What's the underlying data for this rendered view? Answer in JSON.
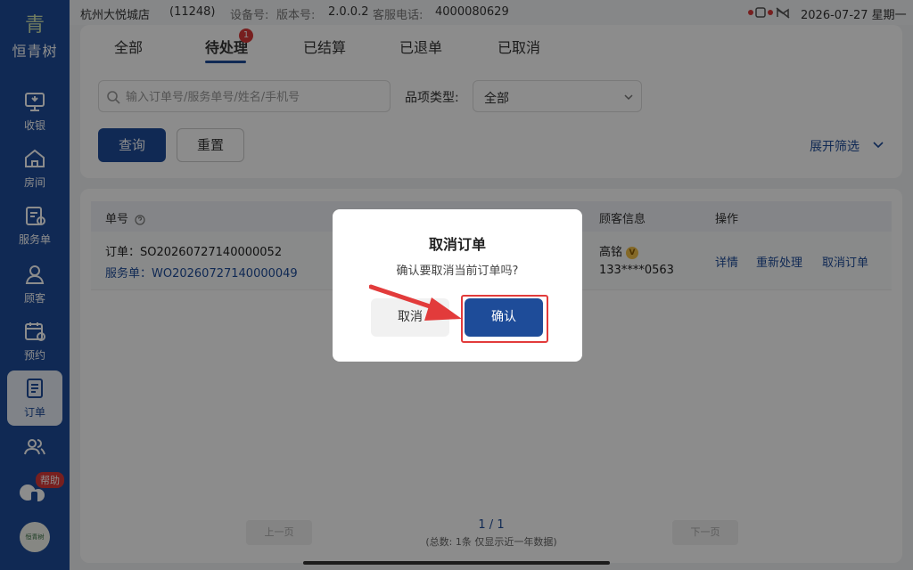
{
  "status_bar": {
    "store_name": "杭州大悦城店",
    "store_id": "(11248)",
    "device_label": "设备号:",
    "version_label": "版本号:",
    "version": "2.0.0.2",
    "service_label": "客服电话:",
    "service_phone": "4000080629",
    "datetime": "2026-07-27 星期一"
  },
  "sidebar": {
    "logo_glyph": "青",
    "logo_text": "恒青树",
    "items": [
      {
        "label": "收银",
        "icon": "cashier-monitor-icon"
      },
      {
        "label": "房间",
        "icon": "home-icon"
      },
      {
        "label": "服务单",
        "icon": "service-order-icon"
      },
      {
        "label": "顾客",
        "icon": "user-icon"
      },
      {
        "label": "预约",
        "icon": "calendar-clock-icon"
      },
      {
        "label": "订单",
        "icon": "order-document-icon",
        "active": true
      },
      {
        "label": "",
        "icon": "staff-group-icon"
      }
    ],
    "help_badge": "帮助",
    "bottom_logo_text": "恒青树"
  },
  "tabs": [
    {
      "label": "全部"
    },
    {
      "label": "待处理",
      "active": true,
      "badge": "1"
    },
    {
      "label": "已结算"
    },
    {
      "label": "已退单"
    },
    {
      "label": "已取消"
    }
  ],
  "filters": {
    "search_placeholder": "输入订单号/服务单号/姓名/手机号",
    "category_label": "品项类型:",
    "category_value": "全部",
    "query_button": "查询",
    "reset_button": "重置",
    "expand_filter": "展开筛选"
  },
  "table": {
    "headers": {
      "order_no": "单号",
      "customer": "顾客信息",
      "action": "操作"
    },
    "row": {
      "order_no": "订单：SO20260727140000052",
      "service_no": "服务单：WO20260727140000049",
      "customer_name": "高铭",
      "vip": "V",
      "customer_phone": "133****0563",
      "actions": [
        "详情",
        "重新处理",
        "取消订单"
      ]
    }
  },
  "pager": {
    "prev": "上一页",
    "next": "下一页",
    "page": "1 / 1",
    "summary": "(总数: 1条 仅显示近一年数据)"
  },
  "dialog": {
    "title": "取消订单",
    "message": "确认要取消当前订单吗?",
    "cancel": "取消",
    "confirm": "确认"
  },
  "colors": {
    "brand": "#1e4c99",
    "badge": "#d93a3a",
    "highlight": "#e23b3b"
  }
}
